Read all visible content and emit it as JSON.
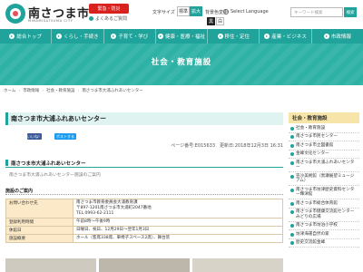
{
  "header": {
    "logo_text": "南さつま市",
    "logo_sub": "MINAMISATSUMA CITY",
    "emergency_label": "緊急・防災",
    "faq_label": "よくあるご質問",
    "font_size_label": "文字サイズ",
    "size_normal": "標準",
    "size_large": "拡大",
    "color_label": "背景色変更",
    "color_black": "黒",
    "color_white": "白",
    "language_label": "Select Language",
    "search_placeholder": "キーワード検索",
    "search_button": "検索"
  },
  "nav": {
    "items": [
      "総合トップ",
      "くらし・手続き",
      "子育て・学び",
      "健康・医療・福祉",
      "移住・定住",
      "産業・ビジネス",
      "市政情報"
    ]
  },
  "banner": {
    "title": "社会・教育施設"
  },
  "breadcrumb": [
    "ホーム",
    "市政情報",
    "社会・教育施設",
    "南さつま市大浦ふれあいセンター"
  ],
  "main": {
    "title": "南さつま市大浦ふれあいセンター",
    "share_like": "いいね！",
    "share_post": "ポストする",
    "meta": "ページ番号:E015633　更新日:2018年12月3日 16:31",
    "heading2": "南さつま市大浦ふれあいセンター",
    "lead": "南さつま市大浦ふれあいセンター施設のご案内",
    "heading3": "施設のご案内",
    "table": [
      {
        "label": "お問い合わせ先",
        "lines": [
          "南さつま市教育委員会大浦教育課",
          "〒897-1201南さつま市大浦町2047番地",
          "TEL.0993-62-2111"
        ]
      },
      {
        "label": "登録利用時間",
        "lines": [
          "午前8時～午後9時"
        ]
      },
      {
        "label": "休館日",
        "lines": [
          "日曜日、祝日、12月29日～翌年1月3日"
        ]
      },
      {
        "label": "施設概要",
        "lines": [
          "ホール（客席338席、車椅子スペース2席）、舞台装"
        ]
      }
    ]
  },
  "sidebar": {
    "heading": "社会・教育施設",
    "items": [
      "社会・教育施設",
      "南さつま市民センター",
      "南さつま市立図書館",
      "金峰文化センター",
      "南さつま市大浦ふれあいセンター",
      "笠沙美術館（黒瀬展望ミュージアム）",
      "南さつま市坊津歴史資料センター輝津館",
      "南さつま市総合体育館",
      "南さつま市健康交流館センターみどりの広場",
      "南さつま市坊泊小学校",
      "坊津海運自然の家",
      "歴史交流館金峰"
    ]
  }
}
